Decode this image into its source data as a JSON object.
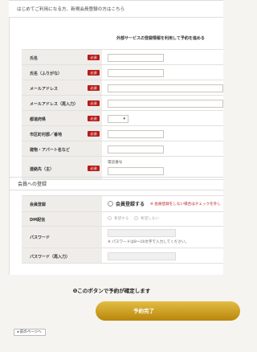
{
  "intro_text": "はじめてご利用になる方、新規会員登録の方はこちら",
  "external_note": "外部サービスの登録情報を利用して予約を進める",
  "required_badge": "必須",
  "reservation_fields": [
    {
      "label": "氏名",
      "required": true
    },
    {
      "label": "氏名（ふりがな）",
      "required": true
    },
    {
      "label": "メールアドレス",
      "required": true
    },
    {
      "label": "メールアドレス（再入力）",
      "required": true
    },
    {
      "label": "都道府県",
      "required": true
    },
    {
      "label": "市区町村郡／番地",
      "required": true
    },
    {
      "label": "建物・アパート名など",
      "required": false
    },
    {
      "label": "連絡先（主）",
      "required": true
    }
  ],
  "phone_caption": "電話番号",
  "member_section_title": "会員への登録",
  "member_fields": {
    "register_label": "会員登録",
    "register_option": "会員登録する",
    "register_note": "※ 会員登録をしない場合はチェックを外し",
    "dm_label": "DM配信",
    "dm_yes": "希望する",
    "dm_no": "希望しない",
    "password_label": "パスワード",
    "password_hint": "※ パスワードは8〜16文字で入力してください。",
    "password_confirm_label": "パスワード（再入力）"
  },
  "confirm_text": "❶このボタンで予約が確定します",
  "submit_label": "予約完了",
  "back_label": "◂ 前のページへ",
  "colors": {
    "required": "#b71c1c",
    "submit": "#c9a02a"
  }
}
